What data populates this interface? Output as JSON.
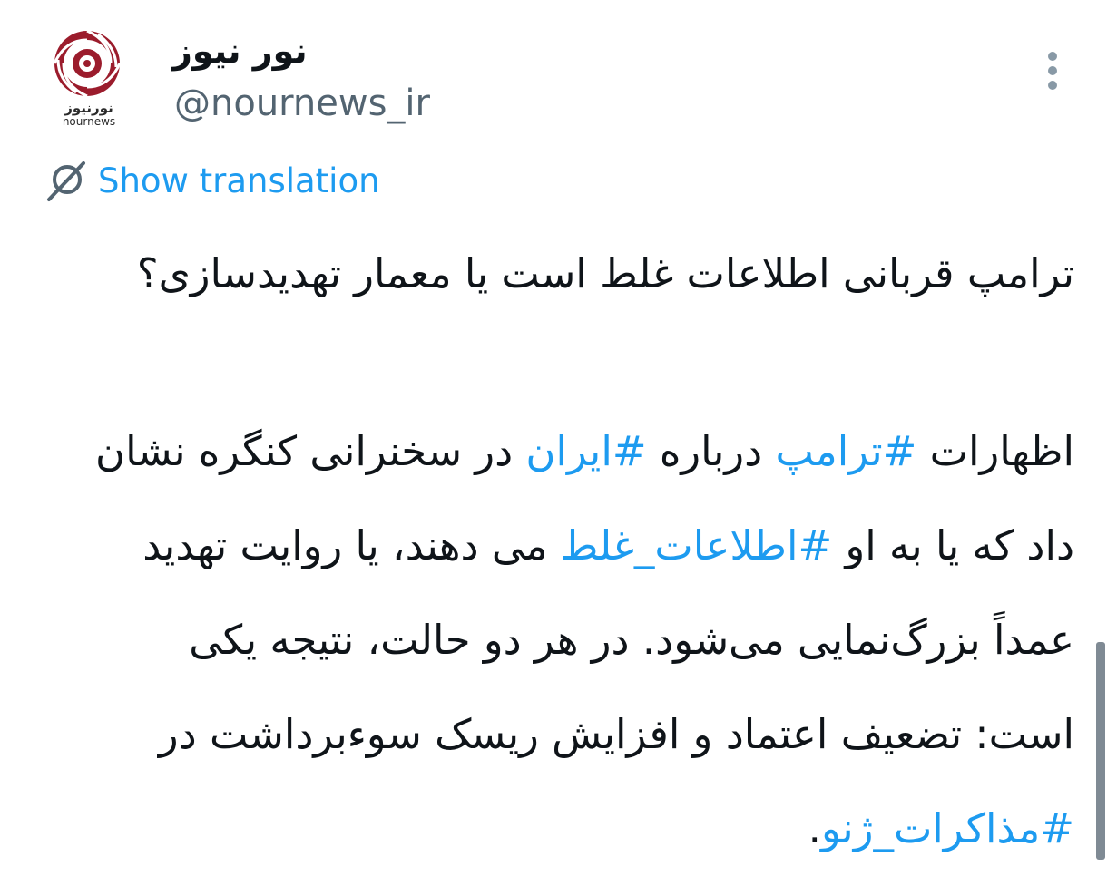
{
  "author": {
    "display_name": "نور نیوز",
    "handle": "@nournews_ir",
    "avatar_logo_fa": "نورنیوز",
    "avatar_logo_en": "nournews"
  },
  "actions": {
    "more_icon": "more-vertical-icon",
    "translate_icon": "translate-globe-icon",
    "show_translation": "Show translation"
  },
  "tweet": {
    "headline": "ترامپ قربانی اطلاعات غلط است یا معمار تهدیدسازی؟",
    "body": {
      "l1_a": "اظهارات ",
      "l1_tag1": "#ترامپ",
      "l1_b": " درباره ",
      "l1_tag2": "#ایران",
      "l1_c": " در سخنرانی کنگره نشان",
      "l2_a": "داد که یا به او ",
      "l2_tag": "#اطلاعات_غلط",
      "l2_b": " می دهند، یا روایت تهدید",
      "l3": "عمداً بزرگ‌نمایی می‌شود. در هر دو حالت، نتیجه یکی",
      "l4": "است: تضعیف اعتماد و افزایش ریسک سوءبرداشت در",
      "l5_tag": "#مذاکرات_ژنو",
      "l5_end": "."
    }
  },
  "colors": {
    "link": "#1d9bf0",
    "text": "#0f1419",
    "secondary": "#536471",
    "brand": "#9b1c2c"
  }
}
